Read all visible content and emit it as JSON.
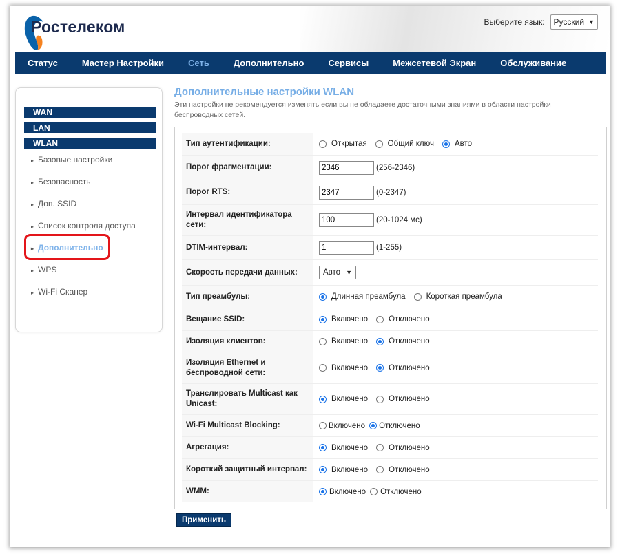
{
  "brand": {
    "name": "Ростелеком",
    "colors": {
      "blue": "#0a62a9",
      "orange": "#f58220",
      "navy": "#0a3a6e"
    }
  },
  "language": {
    "label": "Выберите язык:",
    "selected": "Русский"
  },
  "nav": {
    "items": [
      {
        "label": "Статус",
        "active": false
      },
      {
        "label": "Мастер Настройки",
        "active": false
      },
      {
        "label": "Сеть",
        "active": true
      },
      {
        "label": "Дополнительно",
        "active": false
      },
      {
        "label": "Сервисы",
        "active": false
      },
      {
        "label": "Межсетевой Экран",
        "active": false
      },
      {
        "label": "Обслуживание",
        "active": false
      }
    ]
  },
  "sidebar": {
    "headers": [
      "WAN",
      "LAN",
      "WLAN"
    ],
    "items": [
      {
        "label": "Базовые настройки"
      },
      {
        "label": "Безопасность"
      },
      {
        "label": "Доп. SSID"
      },
      {
        "label": "Список контроля доступа"
      },
      {
        "label": "Дополнительно",
        "active": true
      },
      {
        "label": "WPS"
      },
      {
        "label": "Wi-Fi Сканер"
      }
    ]
  },
  "page": {
    "title": "Дополнительные настройки WLAN",
    "description": "Эти настройки не рекомендуется изменять если вы не обладаете достаточными знаниями в области настройки беспроводных сетей."
  },
  "form": {
    "auth_type": {
      "label": "Тип аутентификации:",
      "options": [
        "Открытая",
        "Общий ключ",
        "Авто"
      ],
      "selected": 2
    },
    "frag": {
      "label": "Порог фрагментации:",
      "value": "2346",
      "hint": "(256-2346)"
    },
    "rts": {
      "label": "Порог RTS:",
      "value": "2347",
      "hint": "(0-2347)"
    },
    "beacon": {
      "label": "Интервал идентификатора сети:",
      "value": "100",
      "hint": "(20-1024 мс)"
    },
    "dtim": {
      "label": "DTIM-интервал:",
      "value": "1",
      "hint": "(1-255)"
    },
    "rate": {
      "label": "Скорость передачи данных:",
      "selected": "Авто"
    },
    "preamble": {
      "label": "Тип преамбулы:",
      "options": [
        "Длинная преамбула",
        "Короткая преамбула"
      ],
      "selected": 0
    },
    "ssid_broadcast": {
      "label": "Вещание SSID:",
      "options": [
        "Включено",
        "Отключено"
      ],
      "selected": 0
    },
    "client_isolation": {
      "label": "Изоляция клиентов:",
      "options": [
        "Включено",
        "Отключено"
      ],
      "selected": 1
    },
    "eth_isolation": {
      "label": "Изоляция Ethernet и беспроводной сети:",
      "options": [
        "Включено",
        "Отключено"
      ],
      "selected": 1
    },
    "mcast_unicast": {
      "label": "Транслировать Multicast как Unicast:",
      "options": [
        "Включено",
        "Отключено"
      ],
      "selected": 0
    },
    "mcast_block": {
      "label": "Wi-Fi Multicast Blocking:",
      "options": [
        "Включено",
        "Отключено"
      ],
      "selected": 1
    },
    "aggregation": {
      "label": "Агрегация:",
      "options": [
        "Включено",
        "Отключено"
      ],
      "selected": 0
    },
    "short_gi": {
      "label": "Короткий защитный интервал:",
      "options": [
        "Включено",
        "Отключено"
      ],
      "selected": 0
    },
    "wmm": {
      "label": "WMM:",
      "options": [
        "Включено",
        "Отключено"
      ],
      "selected": 0
    }
  },
  "apply_label": "Применить"
}
